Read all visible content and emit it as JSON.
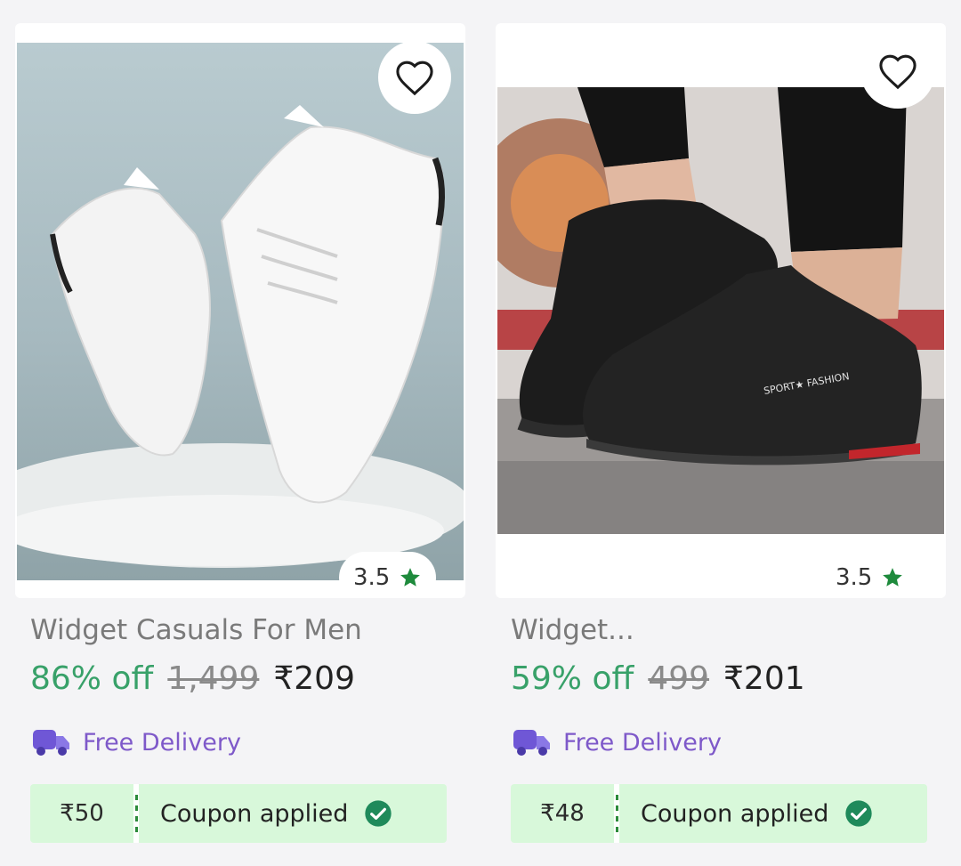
{
  "products": [
    {
      "title": "Widget Casuals For Men",
      "discount": "86% off",
      "mrp": "1,499",
      "price": "₹209",
      "rating": "3.5",
      "delivery": "Free Delivery",
      "coupon_amount": "₹50",
      "coupon_label": "Coupon applied"
    },
    {
      "title": "Widget...",
      "discount": "59% off",
      "mrp": "499",
      "price": "₹201",
      "rating": "3.5",
      "delivery": "Free Delivery",
      "coupon_amount": "₹48",
      "coupon_label": "Coupon applied"
    }
  ],
  "colors": {
    "discount": "#38a169",
    "delivery": "#7e59c9",
    "coupon_bg": "#d8f8da",
    "check": "#1f8a5b",
    "star": "#1e8a3c"
  },
  "icons": [
    "heart-outline-icon",
    "star-icon",
    "delivery-truck-icon",
    "check-circle-icon"
  ]
}
